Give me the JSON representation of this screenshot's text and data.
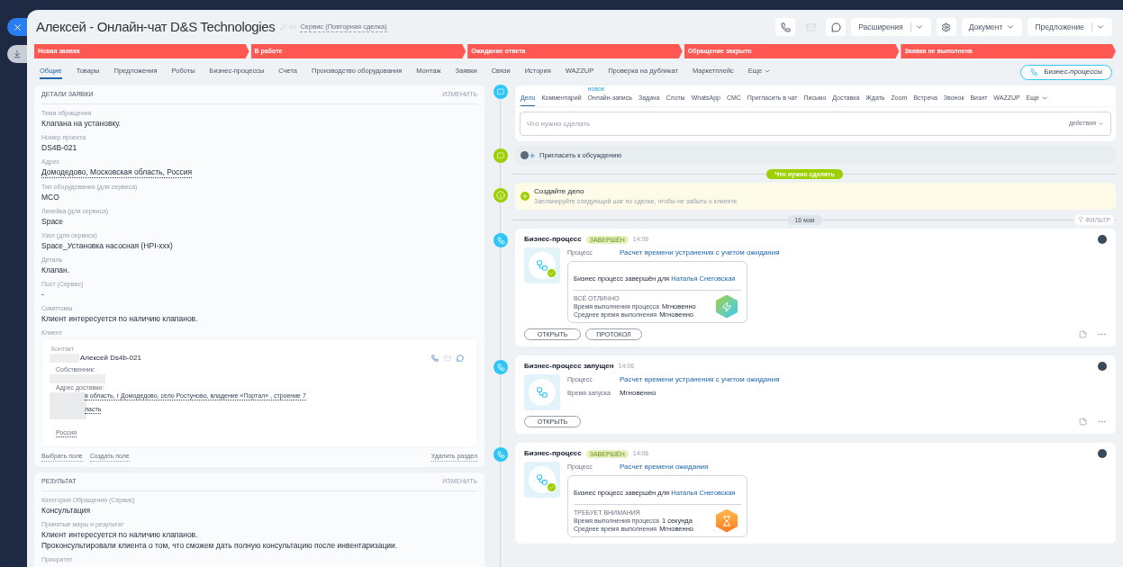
{
  "window": {
    "title": "Алексей - Онлайн-чат D&S Technologies",
    "category": "Сервис (Повторная сделка)"
  },
  "header_buttons": [
    {
      "kind": "icon"
    },
    {
      "kind": "icon",
      "disabled": true
    },
    {
      "kind": "icon"
    },
    {
      "kind": "split",
      "label": "Расширения"
    },
    {
      "kind": "icon"
    },
    {
      "kind": "menu",
      "label": "Документ"
    },
    {
      "kind": "split",
      "label": "Предложение"
    }
  ],
  "stages": [
    {
      "label": "Новая заявка"
    },
    {
      "label": "В работе"
    },
    {
      "label": "Ожидание ответа"
    },
    {
      "label": "Обращение закрыто"
    },
    {
      "label": "Заявка не выполнена"
    }
  ],
  "tabs": [
    {
      "label": "Общие",
      "selected": true
    },
    {
      "label": "Товары",
      "selected": false
    },
    {
      "label": "Предложения",
      "selected": false
    },
    {
      "label": "Роботы",
      "selected": false
    },
    {
      "label": "Бизнес-процессы",
      "selected": false
    },
    {
      "label": "Счета",
      "selected": false
    },
    {
      "label": "Производство оборудования",
      "selected": false
    },
    {
      "label": "Монтаж",
      "selected": false
    },
    {
      "label": "Заявки",
      "selected": false
    },
    {
      "label": "Связи",
      "selected": false
    },
    {
      "label": "История",
      "selected": false
    },
    {
      "label": "WAZZUP",
      "selected": false
    },
    {
      "label": "Проверка на дубликат",
      "selected": false
    },
    {
      "label": "Маркетплейс",
      "selected": false
    },
    {
      "label": "Еще",
      "selected": false
    }
  ],
  "bp_button": "Бизнес-процессы",
  "details": {
    "title": "ДЕТАЛИ ЗАЯВКИ",
    "edit": "ИЗМЕНИТЬ",
    "fields": [
      {
        "kind": "text",
        "label": "Тема обращения",
        "value": "Клапана на установку."
      },
      {
        "kind": "text",
        "label": "Номер проекта",
        "value": "DS4B-021"
      },
      {
        "kind": "link",
        "label": "Адрес",
        "value": "Домодедово, Московская область, Россия"
      },
      {
        "kind": "text",
        "label": "Тип оборудования (для сервиса)",
        "value": "MCO"
      },
      {
        "kind": "text",
        "label": "Линейка (для сервиса)",
        "value": "Space"
      },
      {
        "kind": "text",
        "label": "Узел (для сервиса)",
        "value": "Space_Установка насосная (HPI-xxx)"
      },
      {
        "kind": "text",
        "label": "Деталь",
        "value": "Клапан."
      },
      {
        "kind": "text",
        "label": "Пост (Сервис)",
        "value": "-"
      },
      {
        "kind": "text",
        "label": "Симптомы",
        "value": "Клиент интересуется по наличию клапанов."
      }
    ],
    "client": {
      "label": "Клиент",
      "contact_label": "Контакт",
      "contact_name": "Алексей Ds4b-021",
      "owner_label": "Собственник:",
      "address_label": "Адрес доставки:",
      "address_lines": [
        "я область, г Домодедово, село Ростуново, владение «Портал» , строение 7",
        "ласть",
        "Россия"
      ]
    },
    "footer_links": [
      "Выбрать поле",
      "Создать поле"
    ],
    "delete_link": "Удалить раздел"
  },
  "result": {
    "title": "РЕЗУЛЬТАТ",
    "edit": "ИЗМЕНИТЬ",
    "fields": [
      {
        "label": "Категория Обращения (Сервис)",
        "value": "Консультация"
      },
      {
        "label": "Принятые меры и результат",
        "value": "Клиент интересуется по наличию клапанов.\nПроконсультировали клиента о том, что сможем дать полную консультацию после инвентаризации."
      },
      {
        "label": "Приоритет"
      }
    ]
  },
  "activity_tabs": [
    {
      "label": "Дело",
      "selected": true
    },
    {
      "label": "Комментарий",
      "selected": false
    },
    {
      "label": "Онлайн-запись",
      "selected": false,
      "badge": "новое"
    },
    {
      "label": "Задача",
      "selected": false
    },
    {
      "label": "Слоты",
      "selected": false
    },
    {
      "label": "WhatsApp",
      "selected": false
    },
    {
      "label": "СМС",
      "selected": false
    },
    {
      "label": "Пригласить в чат",
      "selected": false
    },
    {
      "label": "Письмо",
      "selected": false
    },
    {
      "label": "Доставка",
      "selected": false
    },
    {
      "label": "Ждать",
      "selected": false
    },
    {
      "label": "Zoom",
      "selected": false
    },
    {
      "label": "Встреча",
      "selected": false
    },
    {
      "label": "Звонок",
      "selected": false
    },
    {
      "label": "Визит",
      "selected": false
    },
    {
      "label": "WAZZUP",
      "selected": false
    },
    {
      "label": "Еще",
      "selected": false
    }
  ],
  "todo_field": {
    "placeholder": "Что нужно сделать",
    "actions": "действия"
  },
  "invite": "Пригласить к обсуждению",
  "todo_divider": "Что нужно сделать",
  "create_task": {
    "title": "Создайте дело",
    "hint": "Запланируйте следующий шаг по сделке, чтобы не забыть о клиенте"
  },
  "date_divider": "16 мая",
  "filter": "ФИЛЬТР",
  "timeline": [
    {
      "kind": "done",
      "title": "Бизнес-процесс",
      "badge": "ЗАВЕРШЁН",
      "time": "14:06",
      "process_label": "Процесс",
      "process": "Расчет времени устранения с учетом ожидания",
      "result": {
        "kind": "ok",
        "summary": "Бизнес процесс завершён для",
        "user": "Наталья Снеговская",
        "verdict": "ВСЁ ОТЛИЧНО",
        "rows": [
          {
            "label": "Время выполнения процесса",
            "value": "Мгновенно"
          },
          {
            "label": "Среднее время выполнения",
            "value": "Мгновенно"
          }
        ]
      },
      "buttons": [
        "ОТКРЫТЬ",
        "ПРОТОКОЛ"
      ]
    },
    {
      "kind": "started",
      "title": "Бизнес-процесс запущен",
      "time": "14:06",
      "process_label": "Процесс",
      "process": "Расчет времени устранения с учетом ожидания",
      "start_label": "Время запуска",
      "start": "Мгновенно",
      "buttons": [
        "ОТКРЫТЬ"
      ]
    },
    {
      "kind": "done",
      "title": "Бизнес-процесс",
      "badge": "ЗАВЕРШЁН",
      "time": "14:06",
      "process_label": "Процесс",
      "process": "Расчет времени ожидания",
      "result": {
        "kind": "warn",
        "summary": "Бизнес процесс завершён для",
        "user": "Наталья Снеговская",
        "verdict": "ТРЕБУЕТ ВНИМАНИЯ",
        "rows": [
          {
            "label": "Время выполнения процесса",
            "value": "1 секунда"
          },
          {
            "label": "Среднее время выполнения",
            "value": "Мгновенно"
          }
        ]
      }
    }
  ]
}
